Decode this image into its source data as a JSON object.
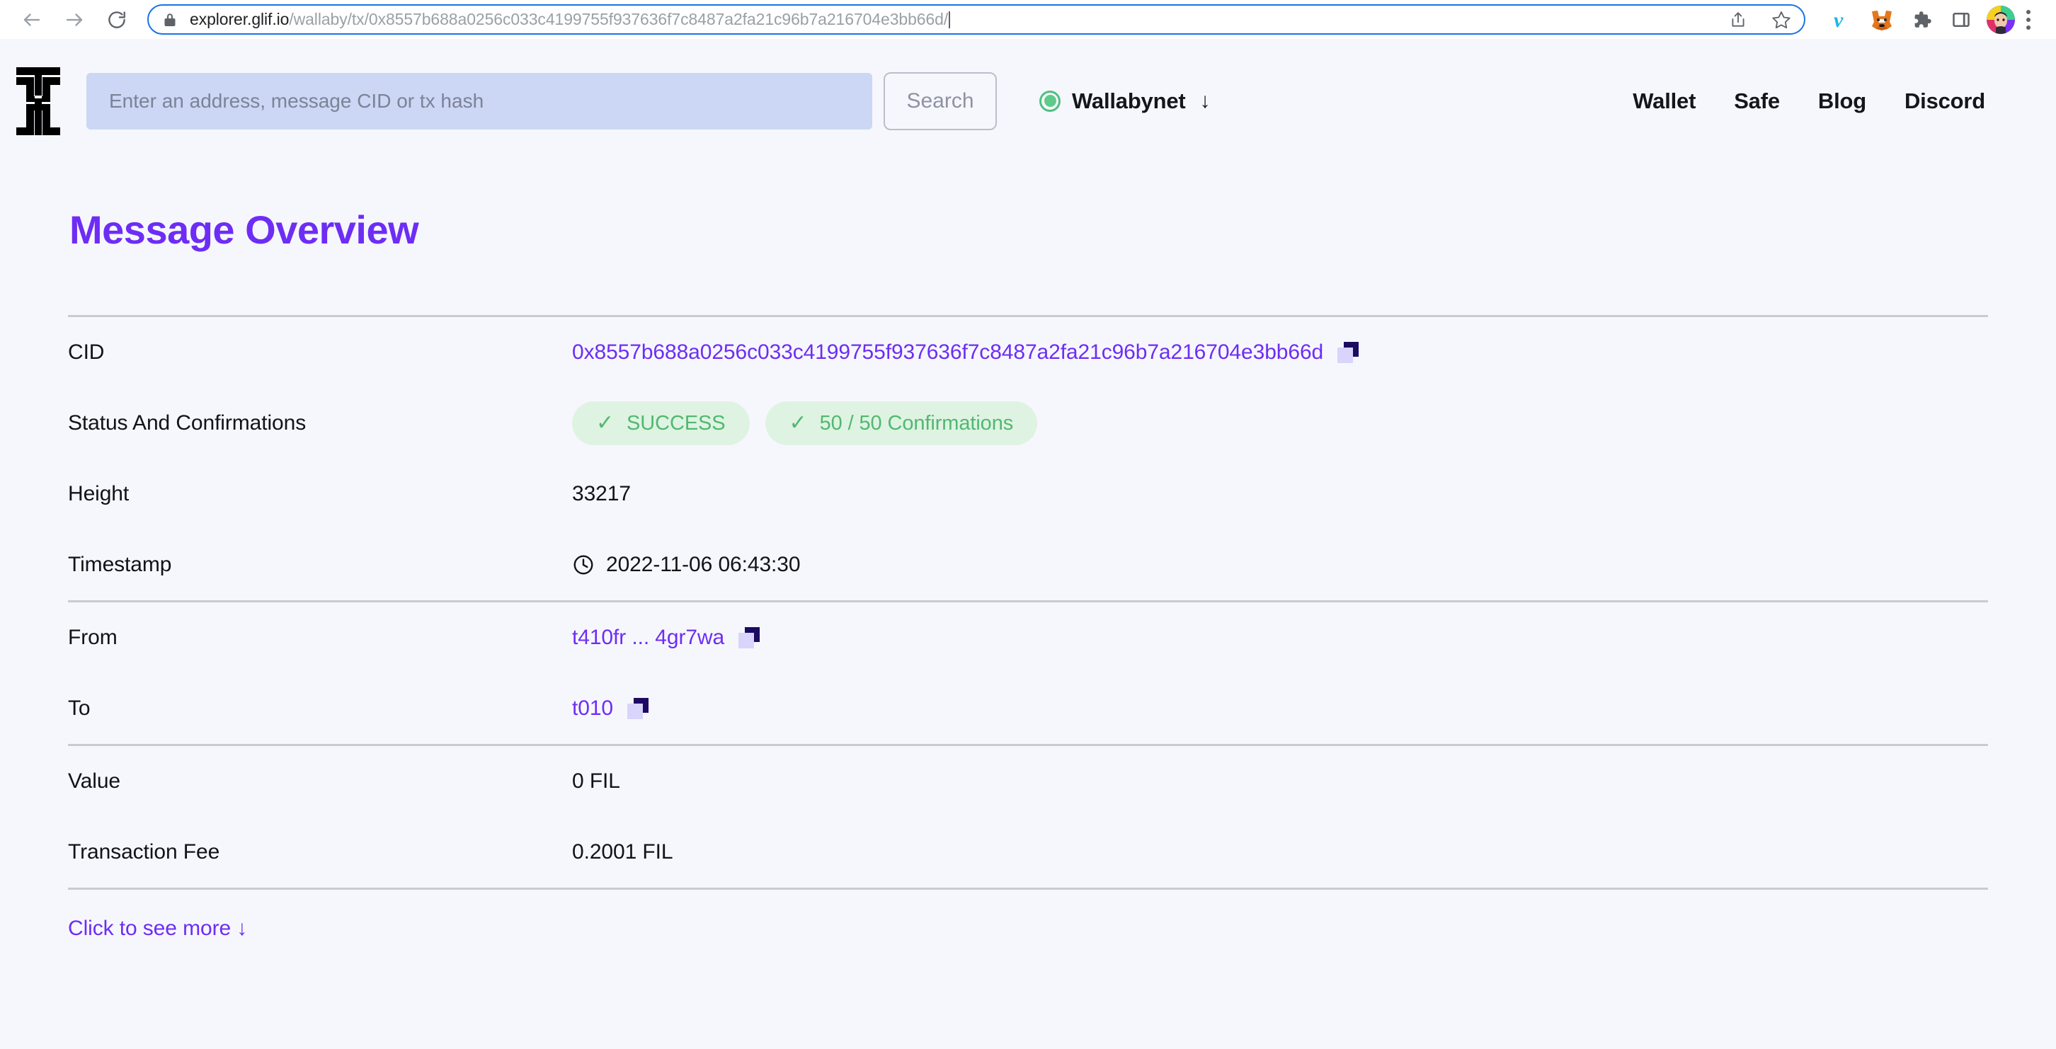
{
  "browser": {
    "back_label": "back",
    "forward_label": "forward",
    "reload_label": "reload",
    "url_host": "explorer.glif.io",
    "url_path": "/wallaby/tx/0x8557b688a0256c033c4199755f937636f7c8487a2fa21c96b7a216704e3bb66d/",
    "share_label": "share",
    "bookmark_label": "bookmark",
    "extensions": [
      "vimeo-icon",
      "metamask-fox-icon",
      "puzzle-extensions-icon",
      "side-panel-icon"
    ],
    "profile_label": "profile",
    "menu_label": "menu"
  },
  "header": {
    "logo_label": "glif-logo",
    "search": {
      "placeholder": "Enter an address, message CID or tx hash",
      "value": "",
      "button_label": "Search"
    },
    "network": {
      "name": "Wallabynet",
      "arrow": "↓",
      "status_color": "#5fcb8a"
    },
    "nav": [
      {
        "label": "Wallet"
      },
      {
        "label": "Safe"
      },
      {
        "label": "Blog"
      },
      {
        "label": "Discord"
      }
    ]
  },
  "main": {
    "title": "Message Overview",
    "groups": [
      {
        "rows": [
          {
            "label": "CID",
            "type": "link-copy",
            "value": "0x8557b688a0256c033c4199755f937636f7c8487a2fa21c96b7a216704e3bb66d"
          },
          {
            "label": "Status And Confirmations",
            "type": "badges",
            "badges": [
              {
                "check": "✓",
                "text": "SUCCESS"
              },
              {
                "check": "✓",
                "text": "50 / 50 Confirmations"
              }
            ]
          },
          {
            "label": "Height",
            "type": "text",
            "value": "33217"
          },
          {
            "label": "Timestamp",
            "type": "clock",
            "value": "2022-11-06 06:43:30"
          }
        ]
      },
      {
        "rows": [
          {
            "label": "From",
            "type": "link-copy",
            "value": "t410fr ... 4gr7wa"
          },
          {
            "label": "To",
            "type": "link-copy",
            "value": "t010"
          }
        ]
      },
      {
        "rows": [
          {
            "label": "Value",
            "type": "text",
            "value": "0 FIL"
          },
          {
            "label": "Transaction Fee",
            "type": "text",
            "value": "0.2001 FIL"
          }
        ]
      }
    ],
    "see_more": "Click to see more ↓"
  },
  "colors": {
    "accent": "#6d2df5",
    "background": "#f6f7fc",
    "success": "#51b871",
    "success_bg": "#dff3e2",
    "search_bg": "#ccd6f5"
  }
}
